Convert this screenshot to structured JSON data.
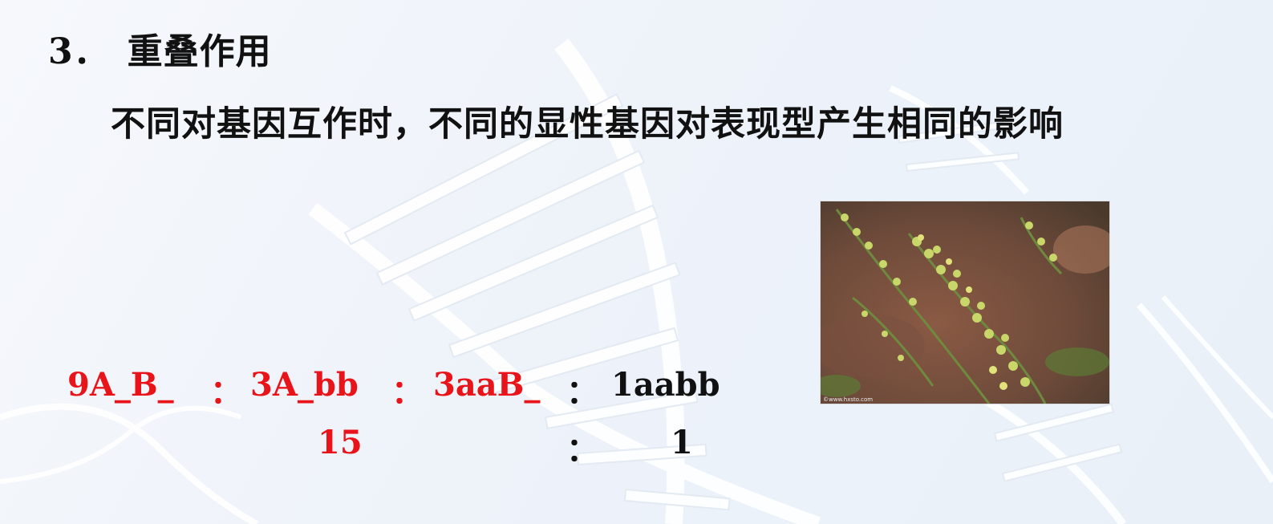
{
  "heading": {
    "number": "3．",
    "title": "重叠作用"
  },
  "definition": "不同对基因互作时，不同的显性基因对表现型产生相同的影响",
  "ratio_line1": {
    "g1": "9A_B_",
    "sep1": "：",
    "g2": "3A_bb",
    "sep2": "：",
    "g3": "3aaB_",
    "sep3": "：",
    "g4": "1aabb"
  },
  "ratio_line2": {
    "combined": "15",
    "sep": "：",
    "single": "1"
  },
  "photo": {
    "subject": "shepherd's purse plant",
    "watermark": "©www.hxsto.com"
  },
  "colors": {
    "highlight": "#e8141a",
    "text": "#111111"
  }
}
